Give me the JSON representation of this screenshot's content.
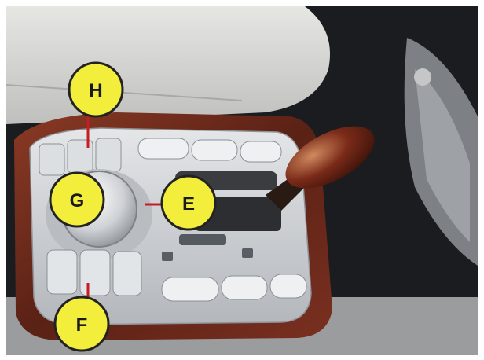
{
  "callouts": [
    {
      "id": "H",
      "text": "H"
    },
    {
      "id": "G",
      "text": "G"
    },
    {
      "id": "E",
      "text": "E"
    },
    {
      "id": "F",
      "text": "F"
    }
  ],
  "colors": {
    "callout_fill": "#f2ee3b",
    "callout_stroke": "#222222",
    "leader_line": "#c41d24",
    "wood_trim": "#6b2a1c",
    "panel_silver": "#c9ccd0",
    "background_dark": "#1b1c20"
  }
}
